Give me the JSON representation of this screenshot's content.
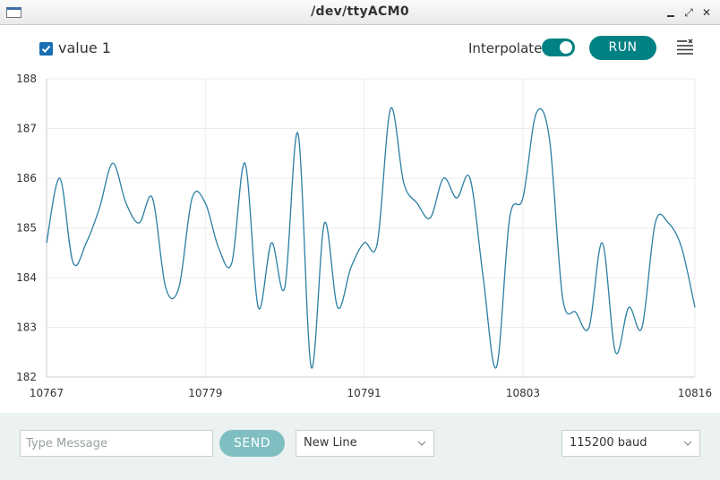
{
  "window": {
    "title": "/dev/ttyACM0",
    "min_icon": "minimize-icon",
    "max_icon": "maximize-icon",
    "close_icon": "close-icon",
    "close_glyph": "✕",
    "max_glyph": "⤢"
  },
  "toolbar": {
    "series_checked": true,
    "series_label": "value 1",
    "interpolate_label": "Interpolate",
    "interpolate_on": true,
    "run_label": "RUN",
    "clear_icon": "clear-list-icon"
  },
  "colors": {
    "accent": "#008184",
    "series_line": "#2a7fa3",
    "send_button": "#7fbfc1",
    "bottom_bar": "#ecf1f1"
  },
  "chart_data": {
    "type": "line",
    "xlim": [
      10767,
      10816
    ],
    "ylim": [
      182,
      188
    ],
    "x_ticks": [
      10767,
      10779,
      10791,
      10803,
      10816
    ],
    "y_ticks": [
      188,
      187,
      186,
      185,
      184,
      183,
      182
    ],
    "grid": true,
    "series": [
      {
        "name": "value 1",
        "x": [
          10767,
          10768,
          10769,
          10770,
          10771,
          10772,
          10773,
          10774,
          10775,
          10776,
          10777,
          10778,
          10779,
          10780,
          10781,
          10782,
          10783,
          10784,
          10785,
          10786,
          10787,
          10788,
          10789,
          10790,
          10791,
          10792,
          10793,
          10794,
          10795,
          10796,
          10797,
          10798,
          10799,
          10800,
          10801,
          10802,
          10803,
          10804,
          10805,
          10806,
          10807,
          10808,
          10809,
          10810,
          10811,
          10812,
          10813,
          10814,
          10815,
          10816
        ],
        "values": [
          184.7,
          186.0,
          184.3,
          184.7,
          185.4,
          186.3,
          185.5,
          185.1,
          185.6,
          183.8,
          183.8,
          185.6,
          185.5,
          184.6,
          184.3,
          186.3,
          183.4,
          184.7,
          183.8,
          186.9,
          182.2,
          185.1,
          183.4,
          184.2,
          184.7,
          184.7,
          187.4,
          185.9,
          185.5,
          185.2,
          186.0,
          185.6,
          186.0,
          184.0,
          182.2,
          185.2,
          185.6,
          187.3,
          186.8,
          183.6,
          183.3,
          183.0,
          184.7,
          182.5,
          183.4,
          183.0,
          185.1,
          185.1,
          184.6,
          183.4
        ]
      }
    ]
  },
  "bottom": {
    "message_placeholder": "Type Message",
    "send_label": "SEND",
    "line_ending": "New Line",
    "baud_rate": "115200 baud",
    "chevron_icon": "chevron-down-icon"
  }
}
